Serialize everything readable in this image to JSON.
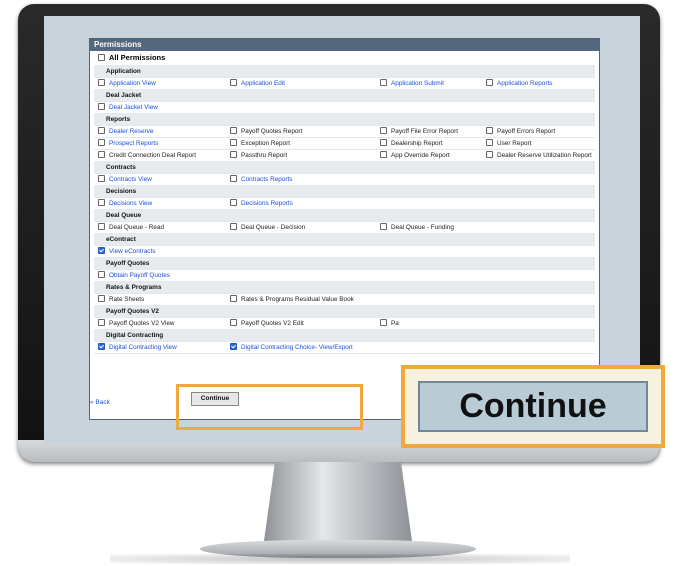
{
  "panel": {
    "title": "Permissions",
    "all_label": "All Permissions",
    "back_label": "Back",
    "continue_label": "Continue"
  },
  "callout": {
    "continue_label": "Continue"
  },
  "colors": {
    "accent": "#f2a93b",
    "header": "#53677d",
    "link": "#1a4fd6",
    "checked": "#2f69d8"
  },
  "rows": [
    {
      "type": "section",
      "label": "Application"
    },
    {
      "type": "items",
      "items": [
        {
          "label": "Application View",
          "link": true,
          "checked": false
        },
        {
          "label": "Application Edit",
          "link": true,
          "checked": false
        },
        {
          "label": "Application Submit",
          "link": true,
          "checked": false
        },
        {
          "label": "Application Reports",
          "link": true,
          "checked": false
        }
      ]
    },
    {
      "type": "section",
      "label": "Deal Jacket"
    },
    {
      "type": "items",
      "items": [
        {
          "label": "Deal Jacket View",
          "link": true,
          "checked": false
        }
      ]
    },
    {
      "type": "section",
      "label": "Reports"
    },
    {
      "type": "items",
      "items": [
        {
          "label": "Dealer Reserve",
          "link": true,
          "checked": false
        },
        {
          "label": "Payoff Quotes Report",
          "link": false,
          "checked": false
        },
        {
          "label": "Payoff File Error Report",
          "link": false,
          "checked": false
        },
        {
          "label": "Payoff Errors Report",
          "link": false,
          "checked": false
        }
      ]
    },
    {
      "type": "items",
      "items": [
        {
          "label": "Prospect Reports",
          "link": true,
          "checked": false
        },
        {
          "label": "Exception Report",
          "link": false,
          "checked": false
        },
        {
          "label": "Dealership Report",
          "link": false,
          "checked": false
        },
        {
          "label": "User Report",
          "link": false,
          "checked": false
        }
      ]
    },
    {
      "type": "items",
      "items": [
        {
          "label": "Credit Connection Deal Report",
          "link": false,
          "checked": false
        },
        {
          "label": "Passthru Report",
          "link": false,
          "checked": false
        },
        {
          "label": "App Override Report",
          "link": false,
          "checked": false
        },
        {
          "label": "Dealer Reserve Utilization Report",
          "link": false,
          "checked": false
        }
      ]
    },
    {
      "type": "section",
      "label": "Contracts"
    },
    {
      "type": "items",
      "items": [
        {
          "label": "Contracts View",
          "link": true,
          "checked": false
        },
        {
          "label": "Contracts Reports",
          "link": true,
          "checked": false
        }
      ]
    },
    {
      "type": "section",
      "label": "Decisions"
    },
    {
      "type": "items",
      "items": [
        {
          "label": "Decisions View",
          "link": true,
          "checked": false
        },
        {
          "label": "Decisions Reports",
          "link": true,
          "checked": false
        }
      ]
    },
    {
      "type": "section",
      "label": "Deal Queue"
    },
    {
      "type": "items",
      "items": [
        {
          "label": "Deal Queue - Read",
          "link": false,
          "checked": false
        },
        {
          "label": "Deal Queue - Decision",
          "link": false,
          "checked": false
        },
        {
          "label": "Deal Queue - Funding",
          "link": false,
          "checked": false
        }
      ]
    },
    {
      "type": "section",
      "label": "eContract"
    },
    {
      "type": "items",
      "items": [
        {
          "label": "View eContracts",
          "link": true,
          "checked": true
        }
      ]
    },
    {
      "type": "section",
      "label": "Payoff Quotes"
    },
    {
      "type": "items",
      "items": [
        {
          "label": "Obtain Payoff Quotes",
          "link": true,
          "checked": false
        }
      ]
    },
    {
      "type": "section",
      "label": "Rates & Programs"
    },
    {
      "type": "items",
      "items": [
        {
          "label": "Rate Sheets",
          "link": false,
          "checked": false
        },
        {
          "label": "Rates & Programs Residual Value Book",
          "link": false,
          "checked": false
        }
      ]
    },
    {
      "type": "section",
      "label": "Payoff Quotes V2"
    },
    {
      "type": "items",
      "items": [
        {
          "label": "Payoff Quotes V2 View",
          "link": false,
          "checked": false
        },
        {
          "label": "Payoff Quotes V2 Edit",
          "link": false,
          "checked": false
        },
        {
          "label": "Pa",
          "link": false,
          "checked": false
        }
      ]
    },
    {
      "type": "section",
      "label": "Digital Contracting"
    },
    {
      "type": "items",
      "items": [
        {
          "label": "Digital Contracting View",
          "link": true,
          "checked": true
        },
        {
          "label": "Digital Contracting Choice- View/Export",
          "link": true,
          "checked": true
        }
      ]
    }
  ]
}
